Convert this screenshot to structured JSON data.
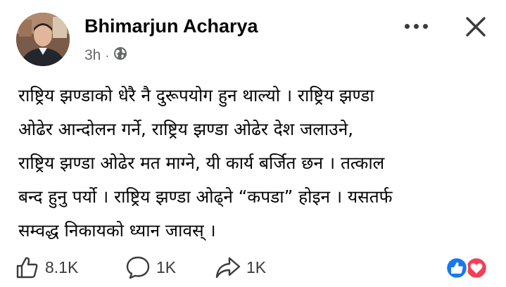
{
  "post": {
    "author": "Bhimarjun Acharya",
    "time": "3h",
    "separator": "·",
    "privacy_icon": "globe-icon",
    "lines": [
      "राष्ट्रिय झण्डाको धेरै नै दुरूपयोग हुन थाल्यो । राष्ट्रिय झण्डा",
      "ओढेर आन्दोलन गर्ने, राष्ट्रिय झण्डा ओढेर देश जलाउने,",
      "राष्ट्रिय झण्डा ओढेर मत माग्ने, यी कार्य बर्जित छन । तत्काल",
      "बन्द हुनु पर्यो । राष्ट्रिय झण्डा ओढ्ने “कपडा” होइन । यसतर्फ",
      "सम्वद्ध निकायको ध्यान जावस् ।"
    ]
  },
  "actions": {
    "like_count": "8.1K",
    "comment_count": "1K",
    "share_count": "1K"
  },
  "colors": {
    "like_blue": "#1877f2",
    "love_red": "#f33e58",
    "meta_gray": "#65676b"
  }
}
